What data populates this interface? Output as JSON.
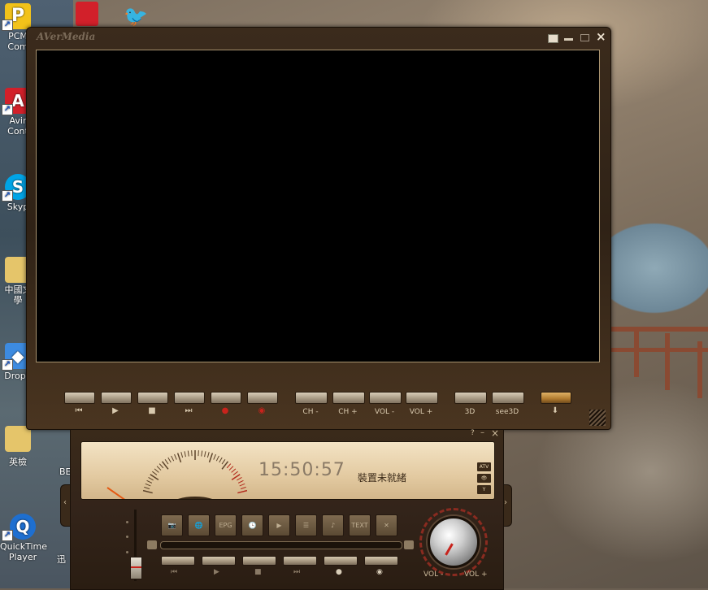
{
  "desktop": {
    "icons": [
      {
        "id": "pcm",
        "label": "PCM\nCom",
        "color": "#f2c21a",
        "glyph": "P"
      },
      {
        "id": "avira",
        "label": "Avir\nCont",
        "color": "#d2202a",
        "glyph": "A"
      },
      {
        "id": "skype",
        "label": "Skyp",
        "color": "#00a4e6",
        "glyph": "S"
      },
      {
        "id": "folder1",
        "label": "中國文\n學",
        "color": "#e5c56a",
        "glyph": ""
      },
      {
        "id": "dropbox",
        "label": "Dropb",
        "color": "#3d8be0",
        "glyph": "◆"
      },
      {
        "id": "folder2",
        "label": "英檢",
        "color": "#e5c56a",
        "glyph": ""
      },
      {
        "id": "quicktime",
        "label": "QuickTime\nPlayer",
        "color": "#1e6fd0",
        "glyph": "Q"
      }
    ],
    "partial_labels": [
      "BE",
      "迅"
    ]
  },
  "main_window": {
    "brand": "AVerMedia",
    "controls": {
      "prev_glyph": "⏮",
      "play_glyph": "▶",
      "stop_glyph": "■",
      "next_glyph": "⏭",
      "record_glyph": "●",
      "timeshift_glyph": "◉",
      "ch_minus": "CH -",
      "ch_plus": "CH +",
      "vol_minus": "VOL -",
      "vol_plus": "VOL +",
      "btn_3d": "3D",
      "btn_see3d": "see3D",
      "collapse_glyph": "⬇"
    }
  },
  "panel": {
    "help": "?",
    "minimize": "–",
    "close": "×",
    "clock": "15:50:57",
    "status": "裝置未就緒",
    "lcd_buttons": [
      "ATV",
      "👁",
      "Y"
    ],
    "features": [
      "📷",
      "🌐",
      "EPG",
      "🕒",
      "▶",
      "☰",
      "♪",
      "TEXT",
      "✕"
    ],
    "transport": [
      "⏮",
      "▶",
      "■",
      "⏭",
      "●",
      "◉"
    ],
    "vol_minus": "VOL -",
    "vol_plus": "VOL +"
  },
  "colors": {
    "accent": "#3b2b1c",
    "lcd": "#e9d4ad",
    "needle_red": "#b22a1c"
  }
}
